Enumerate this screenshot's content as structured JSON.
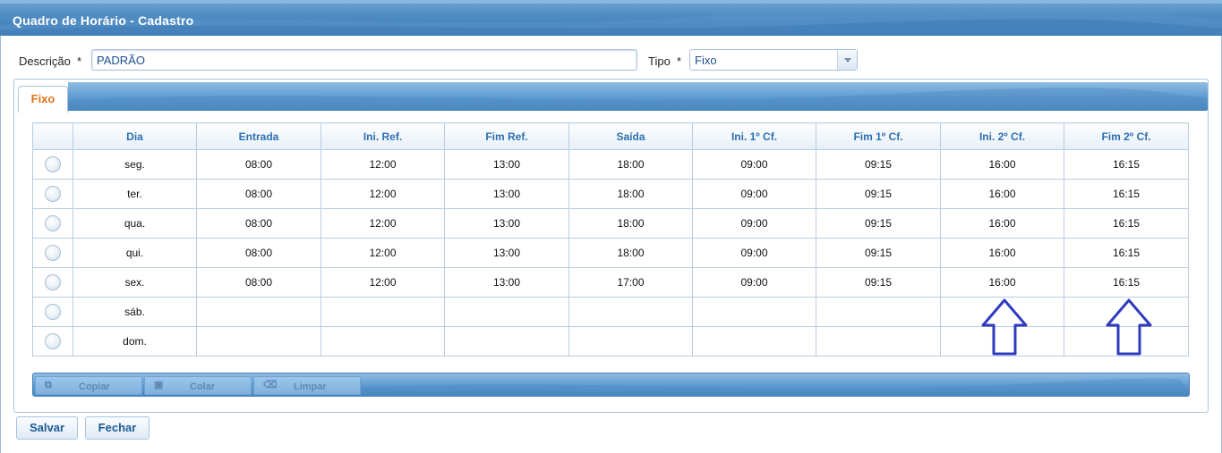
{
  "window": {
    "title": "Quadro de Horário - Cadastro"
  },
  "form": {
    "descricao_label": "Descrição",
    "descricao_value": "PADRÃO",
    "tipo_label": "Tipo",
    "tipo_value": "Fixo",
    "required_mark": "*"
  },
  "tabs": [
    {
      "label": "Fixo",
      "active": true
    }
  ],
  "table": {
    "columns": [
      "",
      "Dia",
      "Entrada",
      "Ini. Ref.",
      "Fim Ref.",
      "Saída",
      "Ini. 1º Cf.",
      "Fim 1º Cf.",
      "Ini. 2º Cf.",
      "Fim 2º Cf."
    ],
    "rows": [
      [
        "seg.",
        "08:00",
        "12:00",
        "13:00",
        "18:00",
        "09:00",
        "09:15",
        "16:00",
        "16:15"
      ],
      [
        "ter.",
        "08:00",
        "12:00",
        "13:00",
        "18:00",
        "09:00",
        "09:15",
        "16:00",
        "16:15"
      ],
      [
        "qua.",
        "08:00",
        "12:00",
        "13:00",
        "18:00",
        "09:00",
        "09:15",
        "16:00",
        "16:15"
      ],
      [
        "qui.",
        "08:00",
        "12:00",
        "13:00",
        "18:00",
        "09:00",
        "09:15",
        "16:00",
        "16:15"
      ],
      [
        "sex.",
        "08:00",
        "12:00",
        "13:00",
        "17:00",
        "09:00",
        "09:15",
        "16:00",
        "16:15"
      ],
      [
        "sáb.",
        "",
        "",
        "",
        "",
        "",
        "",
        "",
        ""
      ],
      [
        "dom.",
        "",
        "",
        "",
        "",
        "",
        "",
        "",
        ""
      ]
    ]
  },
  "toolbar": {
    "copy_label": "Copiar",
    "paste_label": "Colar",
    "clear_label": "Limpar"
  },
  "footer": {
    "save_label": "Salvar",
    "close_label": "Fechar"
  },
  "colors": {
    "accent_tab": "#e0731b",
    "header_text": "#2c6fb2",
    "annotation_arrow": "#2e3bbf"
  }
}
